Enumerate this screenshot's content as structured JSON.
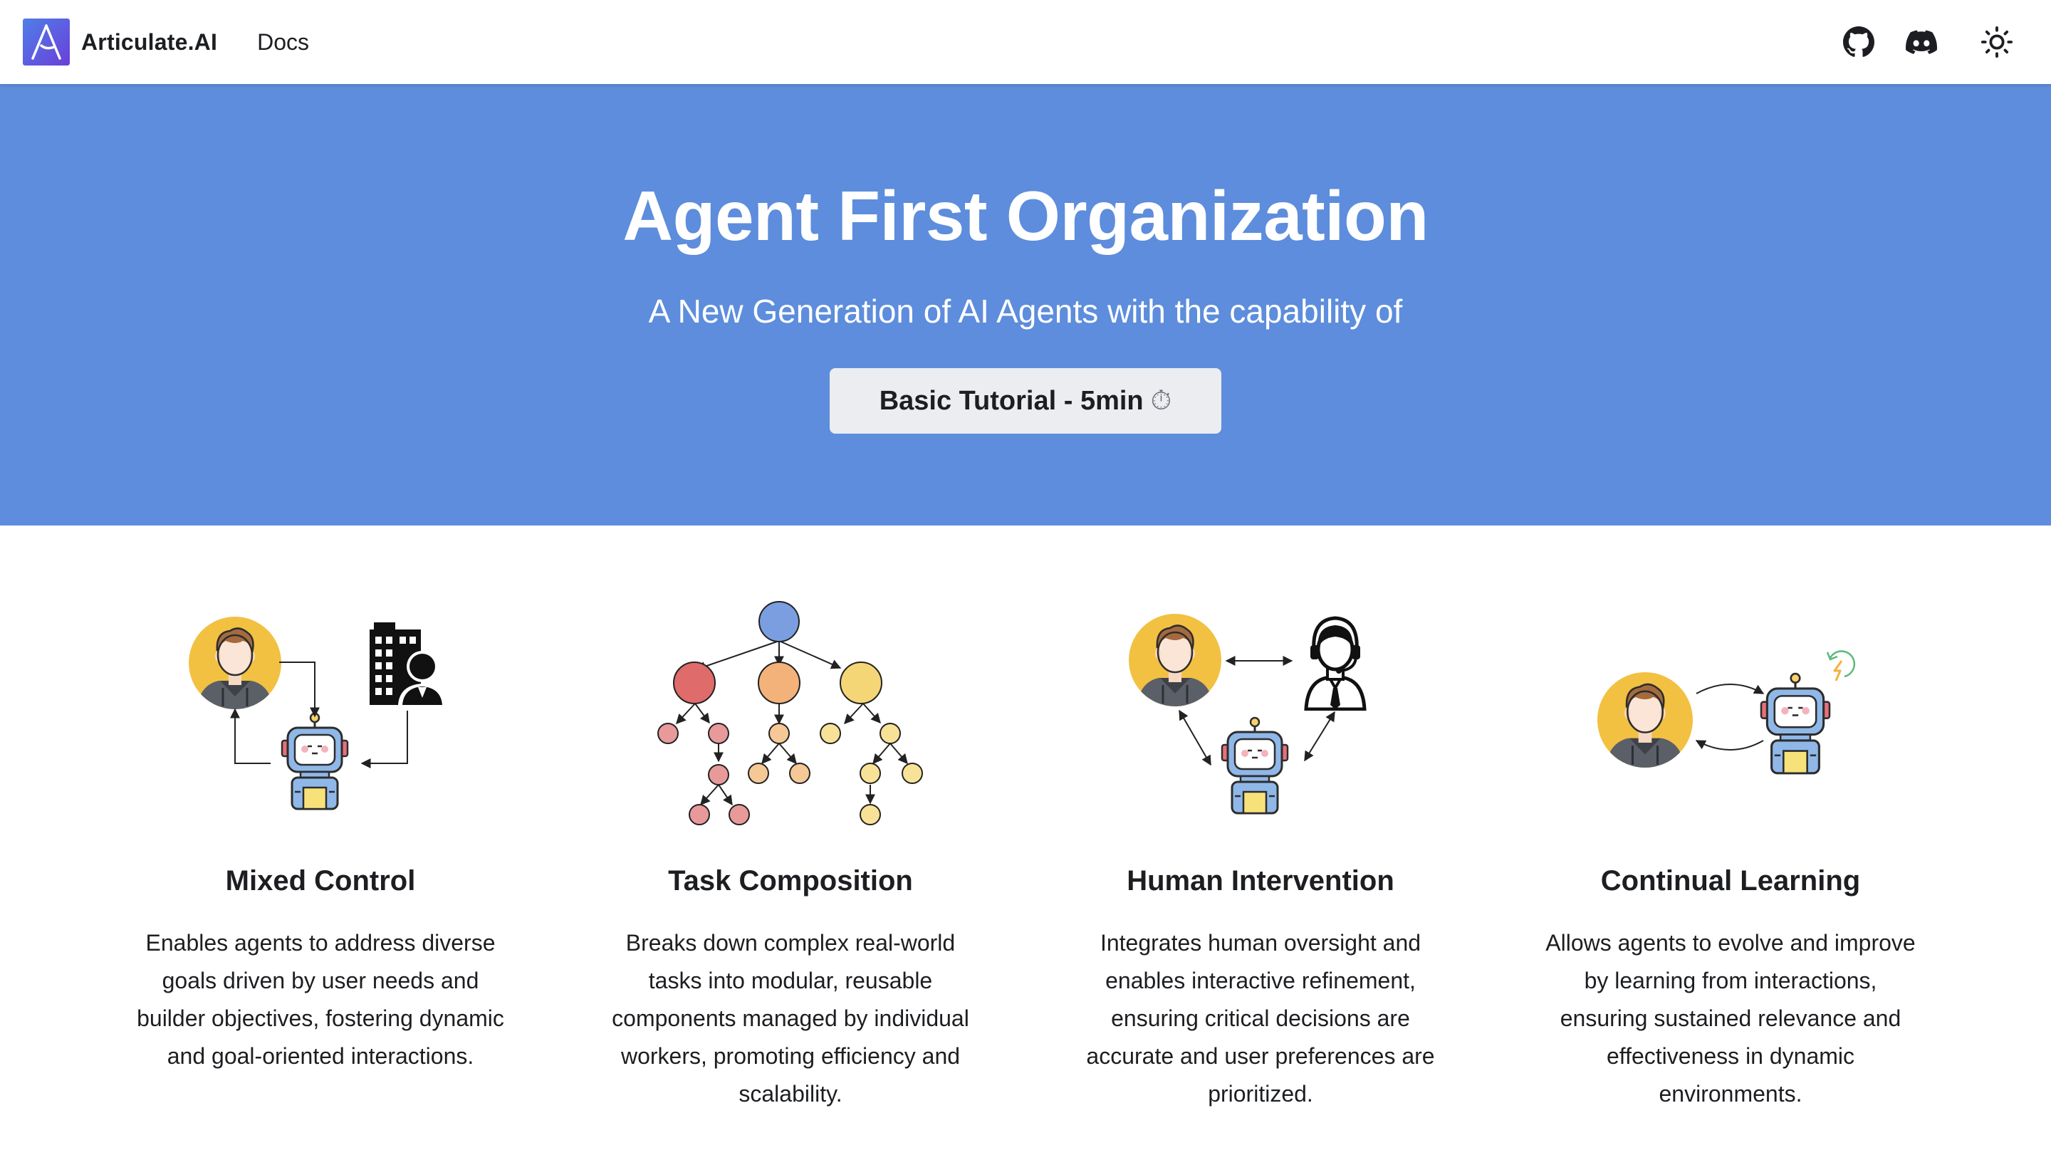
{
  "navbar": {
    "brand_name": "Articulate.AI",
    "links": [
      {
        "label": "Docs"
      }
    ],
    "icons": [
      "github-icon",
      "discord-icon",
      "sun-icon"
    ]
  },
  "hero": {
    "title": "Agent First Organization",
    "subtitle": "A New Generation of AI Agents with the capability of",
    "button_label": "Basic Tutorial - 5min",
    "button_icon": "⏱",
    "background": "#5d8ddc"
  },
  "features": [
    {
      "title": "Mixed Control",
      "description": "Enables agents to address diverse goals driven by user needs and builder objectives, fostering dynamic and goal-oriented interactions.",
      "icon": "mixed-control-illustration"
    },
    {
      "title": "Task Composition",
      "description": "Breaks down complex real-world tasks into modular, reusable components managed by individual workers, promoting efficiency and scalability.",
      "icon": "task-tree-illustration"
    },
    {
      "title": "Human Intervention",
      "description": "Integrates human oversight and enables interactive refinement, ensuring critical decisions are accurate and user preferences are prioritized.",
      "icon": "human-intervention-illustration"
    },
    {
      "title": "Continual Learning",
      "description": "Allows agents to evolve and improve by learning from interactions, ensuring sustained relevance and effectiveness in dynamic environments.",
      "icon": "continual-learning-illustration"
    }
  ]
}
